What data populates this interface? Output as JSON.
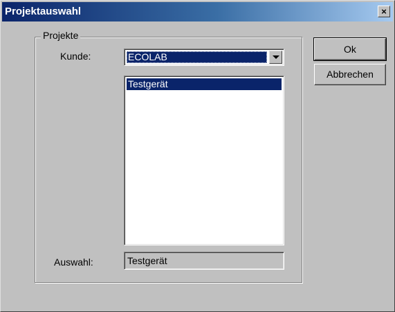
{
  "window": {
    "title": "Projektauswahl",
    "close_label": "×"
  },
  "group": {
    "label": "Projekte"
  },
  "customer": {
    "label": "Kunde:",
    "value": "ECOLAB"
  },
  "projects": {
    "items": [
      {
        "label": "Testgerät",
        "selected": true
      }
    ]
  },
  "selection": {
    "label": "Auswahl:",
    "value": "Testgerät"
  },
  "buttons": {
    "ok_label": "Ok",
    "cancel_label": "Abbrechen"
  },
  "colors": {
    "titlebar": "#0a246a",
    "highlight": "#0a246a",
    "face": "#c0c0c0"
  },
  "icons": {
    "close": "close-icon",
    "dropdown": "chevron-down-icon"
  }
}
